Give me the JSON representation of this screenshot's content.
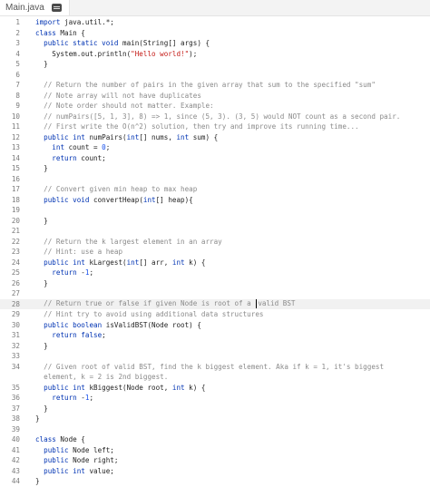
{
  "tab": {
    "filename": "Main.java",
    "icon": "doc-icon"
  },
  "lines": [
    {
      "n": "1",
      "tokens": [
        {
          "c": "kw",
          "t": "import"
        },
        {
          "t": " java.util.*;"
        }
      ]
    },
    {
      "n": "2",
      "tokens": [
        {
          "c": "kw",
          "t": "class"
        },
        {
          "t": " Main {"
        }
      ]
    },
    {
      "n": "3",
      "tokens": [
        {
          "t": "  "
        },
        {
          "c": "kw",
          "t": "public static void"
        },
        {
          "t": " main(String[] args) {"
        }
      ]
    },
    {
      "n": "4",
      "tokens": [
        {
          "t": "    System.out.println("
        },
        {
          "c": "str",
          "t": "\"Hello world!\""
        },
        {
          "t": ");"
        }
      ]
    },
    {
      "n": "5",
      "tokens": [
        {
          "t": "  }"
        }
      ]
    },
    {
      "n": "6",
      "tokens": [
        {
          "t": ""
        }
      ]
    },
    {
      "n": "7",
      "tokens": [
        {
          "t": "  "
        },
        {
          "c": "cm",
          "t": "// Return the number of pairs in the given array that sum to the specified \"sum\""
        }
      ]
    },
    {
      "n": "8",
      "tokens": [
        {
          "t": "  "
        },
        {
          "c": "cm",
          "t": "// Note array will not have duplicates"
        }
      ]
    },
    {
      "n": "9",
      "tokens": [
        {
          "t": "  "
        },
        {
          "c": "cm",
          "t": "// Note order should not matter. Example:"
        }
      ]
    },
    {
      "n": "10",
      "tokens": [
        {
          "t": "  "
        },
        {
          "c": "cm",
          "t": "// numPairs([5, 1, 3], 8) => 1, since (5, 3). (3, 5) would NOT count as a second pair."
        }
      ]
    },
    {
      "n": "11",
      "tokens": [
        {
          "t": "  "
        },
        {
          "c": "cm",
          "t": "// First write the O(n^2) solution, then try and improve its running time..."
        }
      ]
    },
    {
      "n": "12",
      "tokens": [
        {
          "t": "  "
        },
        {
          "c": "kw",
          "t": "public int"
        },
        {
          "t": " numPairs("
        },
        {
          "c": "kw",
          "t": "int"
        },
        {
          "t": "[] nums, "
        },
        {
          "c": "kw",
          "t": "int"
        },
        {
          "t": " sum) {"
        }
      ]
    },
    {
      "n": "13",
      "tokens": [
        {
          "t": "    "
        },
        {
          "c": "kw",
          "t": "int"
        },
        {
          "t": " count = "
        },
        {
          "c": "num",
          "t": "0"
        },
        {
          "t": ";"
        }
      ]
    },
    {
      "n": "14",
      "tokens": [
        {
          "t": "    "
        },
        {
          "c": "kw",
          "t": "return"
        },
        {
          "t": " count;"
        }
      ]
    },
    {
      "n": "15",
      "tokens": [
        {
          "t": "  }"
        }
      ]
    },
    {
      "n": "16",
      "tokens": [
        {
          "t": ""
        }
      ]
    },
    {
      "n": "17",
      "tokens": [
        {
          "t": "  "
        },
        {
          "c": "cm",
          "t": "// Convert given min heap to max heap"
        }
      ]
    },
    {
      "n": "18",
      "tokens": [
        {
          "t": "  "
        },
        {
          "c": "kw",
          "t": "public void"
        },
        {
          "t": " convertHeap("
        },
        {
          "c": "kw",
          "t": "int"
        },
        {
          "t": "[] heap){"
        }
      ]
    },
    {
      "n": "19",
      "tokens": [
        {
          "t": ""
        }
      ]
    },
    {
      "n": "20",
      "tokens": [
        {
          "t": "  }"
        }
      ]
    },
    {
      "n": "21",
      "tokens": [
        {
          "t": ""
        }
      ]
    },
    {
      "n": "22",
      "tokens": [
        {
          "t": "  "
        },
        {
          "c": "cm",
          "t": "// Return the k largest element in an array"
        }
      ]
    },
    {
      "n": "23",
      "tokens": [
        {
          "t": "  "
        },
        {
          "c": "cm",
          "t": "// Hint: use a heap"
        }
      ]
    },
    {
      "n": "24",
      "tokens": [
        {
          "t": "  "
        },
        {
          "c": "kw",
          "t": "public int"
        },
        {
          "t": " kLargest("
        },
        {
          "c": "kw",
          "t": "int"
        },
        {
          "t": "[] arr, "
        },
        {
          "c": "kw",
          "t": "int"
        },
        {
          "t": " k) {"
        }
      ]
    },
    {
      "n": "25",
      "tokens": [
        {
          "t": "    "
        },
        {
          "c": "kw",
          "t": "return"
        },
        {
          "t": " -"
        },
        {
          "c": "num",
          "t": "1"
        },
        {
          "t": ";"
        }
      ]
    },
    {
      "n": "26",
      "tokens": [
        {
          "t": "  }"
        }
      ]
    },
    {
      "n": "27",
      "tokens": [
        {
          "t": ""
        }
      ]
    },
    {
      "n": "28",
      "active": true,
      "tokens": [
        {
          "t": "  "
        },
        {
          "c": "cm",
          "t": "// Return true or false if given Node is root of a "
        },
        {
          "caret": true
        },
        {
          "c": "cm",
          "t": "valid BST"
        }
      ]
    },
    {
      "n": "29",
      "tokens": [
        {
          "t": "  "
        },
        {
          "c": "cm",
          "t": "// Hint try to avoid using additional data structures"
        }
      ]
    },
    {
      "n": "30",
      "tokens": [
        {
          "t": "  "
        },
        {
          "c": "kw",
          "t": "public boolean"
        },
        {
          "t": " isValidBST(Node root) {"
        }
      ]
    },
    {
      "n": "31",
      "tokens": [
        {
          "t": "    "
        },
        {
          "c": "kw",
          "t": "return false"
        },
        {
          "t": ";"
        }
      ]
    },
    {
      "n": "32",
      "tokens": [
        {
          "t": "  }"
        }
      ]
    },
    {
      "n": "33",
      "tokens": [
        {
          "t": ""
        }
      ]
    },
    {
      "n": "34",
      "tokens": [
        {
          "t": "  "
        },
        {
          "c": "cm",
          "t": "// Given root of valid BST, find the k biggest element. Aka if k = 1, it's biggest"
        }
      ]
    },
    {
      "n": "",
      "wrap": true,
      "tokens": [
        {
          "t": "  "
        },
        {
          "c": "cm",
          "t": "element, k = 2 is 2nd biggest."
        }
      ]
    },
    {
      "n": "35",
      "tokens": [
        {
          "t": "  "
        },
        {
          "c": "kw",
          "t": "public int"
        },
        {
          "t": " kBiggest(Node root, "
        },
        {
          "c": "kw",
          "t": "int"
        },
        {
          "t": " k) {"
        }
      ]
    },
    {
      "n": "36",
      "tokens": [
        {
          "t": "    "
        },
        {
          "c": "kw",
          "t": "return"
        },
        {
          "t": " -"
        },
        {
          "c": "num",
          "t": "1"
        },
        {
          "t": ";"
        }
      ]
    },
    {
      "n": "37",
      "tokens": [
        {
          "t": "  }"
        }
      ]
    },
    {
      "n": "38",
      "tokens": [
        {
          "t": "}"
        }
      ]
    },
    {
      "n": "39",
      "tokens": [
        {
          "t": ""
        }
      ]
    },
    {
      "n": "40",
      "tokens": [
        {
          "c": "kw",
          "t": "class"
        },
        {
          "t": " Node {"
        }
      ]
    },
    {
      "n": "41",
      "tokens": [
        {
          "t": "  "
        },
        {
          "c": "kw",
          "t": "public"
        },
        {
          "t": " Node left;"
        }
      ]
    },
    {
      "n": "42",
      "tokens": [
        {
          "t": "  "
        },
        {
          "c": "kw",
          "t": "public"
        },
        {
          "t": " Node right;"
        }
      ]
    },
    {
      "n": "43",
      "tokens": [
        {
          "t": "  "
        },
        {
          "c": "kw",
          "t": "public int"
        },
        {
          "t": " value;"
        }
      ]
    },
    {
      "n": "44",
      "tokens": [
        {
          "t": "}"
        }
      ]
    }
  ]
}
